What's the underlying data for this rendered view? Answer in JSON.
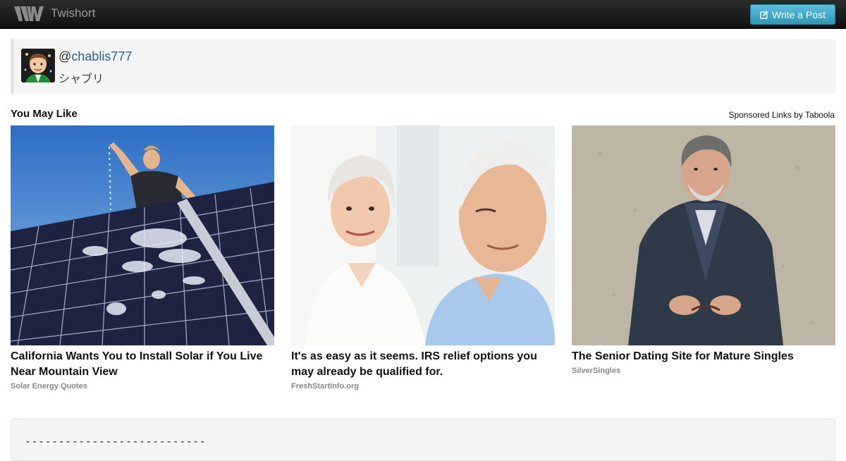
{
  "navbar": {
    "brand": "Twishort",
    "write_button": "Write a Post",
    "icons": {
      "logo": "twishort-logo-icon",
      "write": "edit-icon"
    }
  },
  "author": {
    "handle_prefix": "@",
    "handle": "chablis777",
    "display_name": "シャブリ"
  },
  "recommendations": {
    "title": "You May Like",
    "sponsored_label": "Sponsored Links by Taboola",
    "items": [
      {
        "headline": "California Wants You to Install Solar if You Live Near Mountain View",
        "source": "Solar Energy Quotes"
      },
      {
        "headline": "It's as easy as it seems. IRS relief options you may already be qualified for.",
        "source": "FreshStartInfo.org"
      },
      {
        "headline": "The Senior Dating Site for Mature Singles",
        "source": "SilverSingles"
      }
    ]
  },
  "post_box": {
    "text": "---------------------------"
  },
  "colors": {
    "navbar_bg": "#1b1b1b",
    "brand_text": "#9d9d9d",
    "button_bg": "#49afcd",
    "link": "#2a6496",
    "card_bg": "#f5f5f5"
  }
}
